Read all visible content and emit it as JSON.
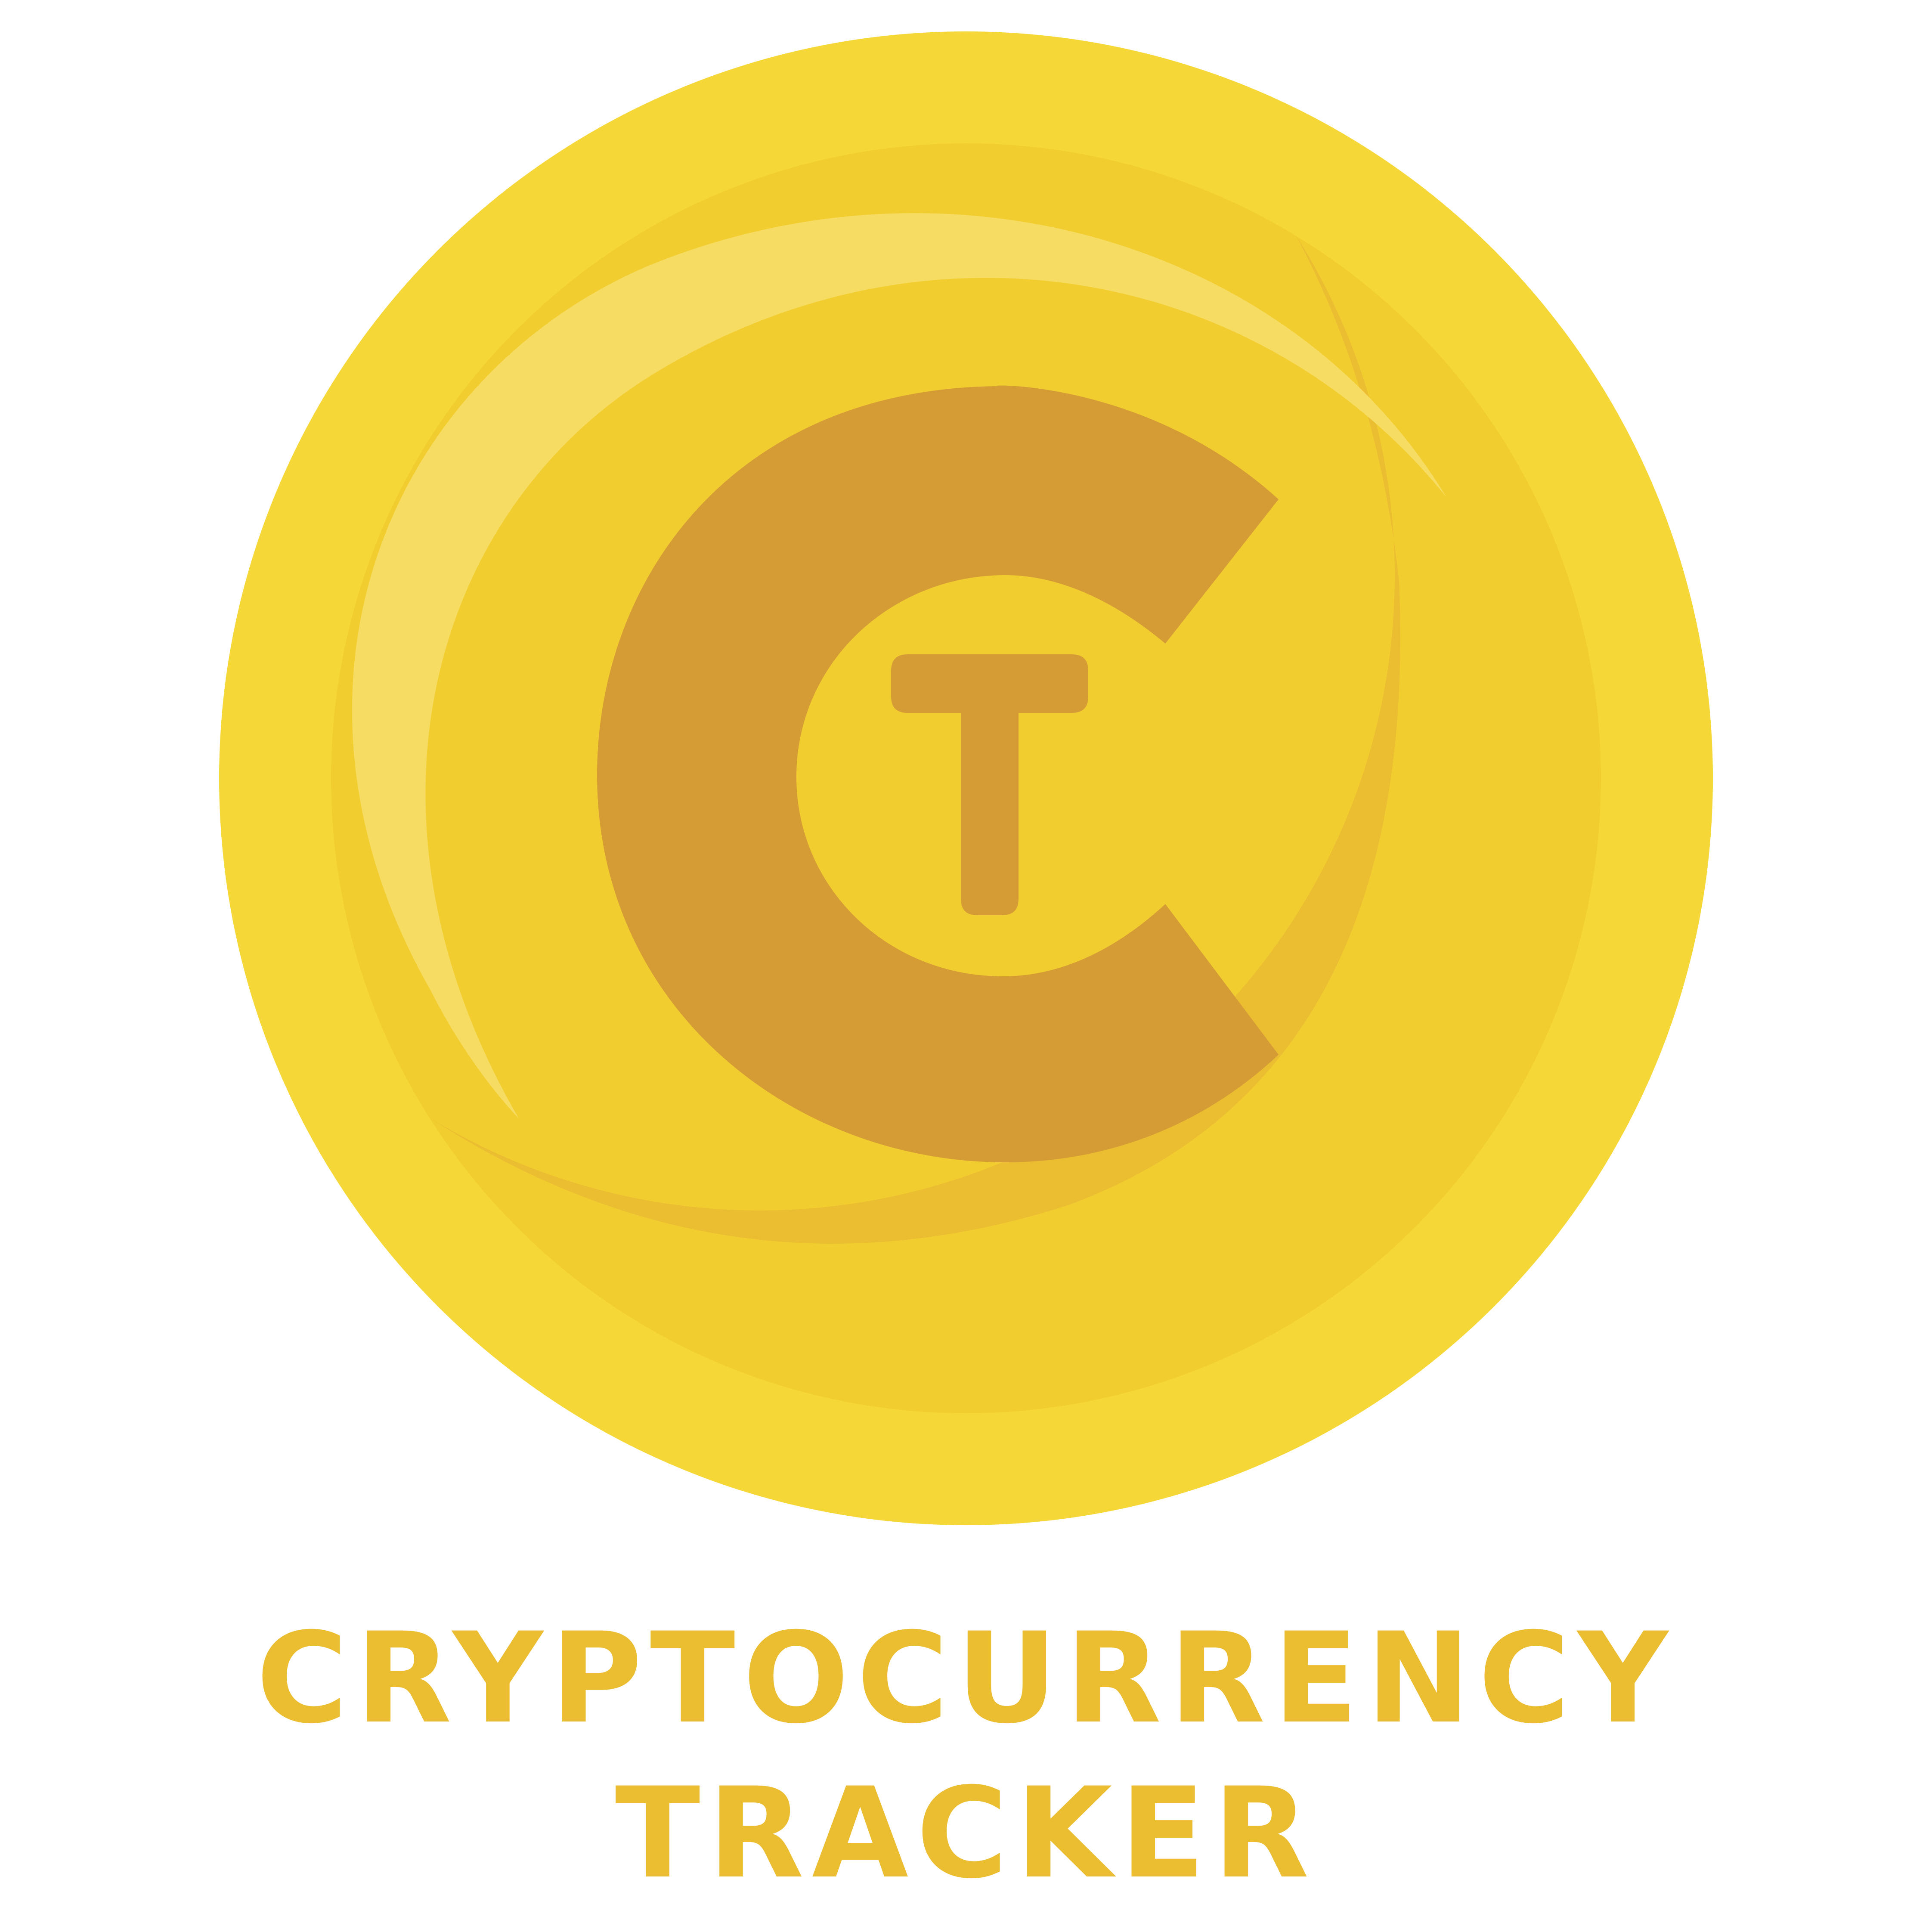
{
  "logo": {
    "emblem_letters": "CT",
    "wordmark_line_1": "CRYPTOCURRENCY",
    "wordmark_line_2": "TRACKER"
  },
  "colors": {
    "outer_ring": "#f5d838",
    "coin_face": "#f2cd30",
    "coin_shadow": "#ebbd31",
    "highlight": "#f6dc62",
    "letter": "#d59c35",
    "text": "#ebbd31",
    "background": "#ffffff"
  }
}
